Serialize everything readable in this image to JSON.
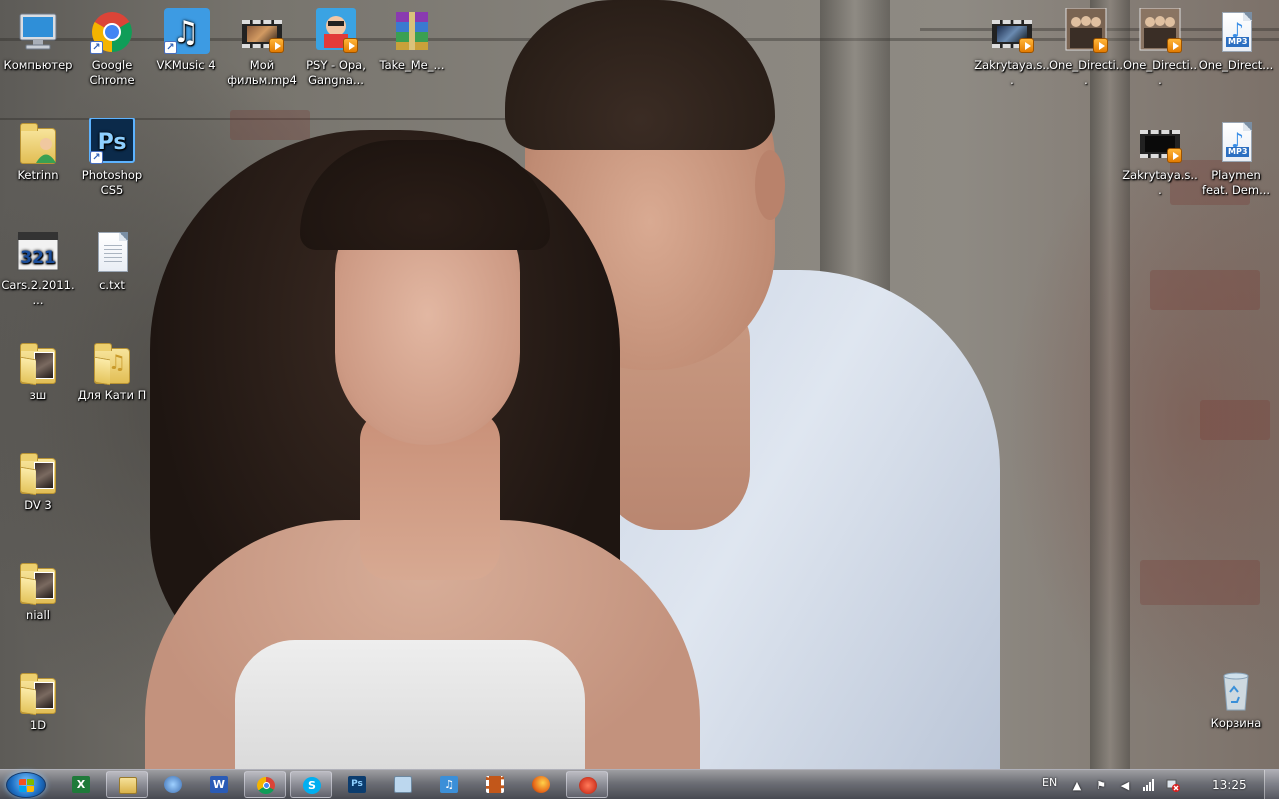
{
  "desktop": {
    "icons": [
      {
        "label": "Компьютер",
        "icon": "computer-icon"
      },
      {
        "label": "Google Chrome",
        "icon": "chrome-icon"
      },
      {
        "label": "VKMusic 4",
        "icon": "vkmusic-icon"
      },
      {
        "label": "Мой фильм.mp4",
        "icon": "video-file-icon"
      },
      {
        "label": "PSY - Opa, Gangna...",
        "icon": "video-file-icon"
      },
      {
        "label": "Take_Me_...",
        "icon": "winrar-archive-icon"
      },
      {
        "label": "Ketrinn",
        "icon": "user-folder-icon"
      },
      {
        "label": "Photoshop CS5",
        "icon": "photoshop-icon"
      },
      {
        "label": "Cars.2.2011....",
        "icon": "media-player-classic-icon"
      },
      {
        "label": "c.txt",
        "icon": "text-file-icon"
      },
      {
        "label": "зш",
        "icon": "folder-icon"
      },
      {
        "label": "Для Кати П",
        "icon": "folder-icon"
      },
      {
        "label": "DV 3",
        "icon": "folder-icon"
      },
      {
        "label": "niall",
        "icon": "folder-icon"
      },
      {
        "label": "1D",
        "icon": "folder-icon"
      },
      {
        "label": "Zakrytaya.s...",
        "icon": "video-file-icon"
      },
      {
        "label": "One_Directi...",
        "icon": "video-file-icon"
      },
      {
        "label": "One_Directi...",
        "icon": "video-file-icon"
      },
      {
        "label": "One_Direct...",
        "icon": "mp3-file-icon"
      },
      {
        "label": "Zakrytaya.s...",
        "icon": "video-file-icon"
      },
      {
        "label": "Playmen feat. Dem...",
        "icon": "mp3-file-icon"
      },
      {
        "label": "Корзина",
        "icon": "recycle-bin-icon"
      }
    ]
  },
  "taskbar": {
    "pinned": [
      {
        "name": "excel",
        "letter": "X",
        "color": "#1f7a3a"
      },
      {
        "name": "explorer",
        "letter": "",
        "color": "#e5c35a"
      },
      {
        "name": "media",
        "letter": "",
        "color": "#3d6fb3"
      },
      {
        "name": "word",
        "letter": "W",
        "color": "#2a5bb6"
      },
      {
        "name": "chrome",
        "letter": "",
        "color": "#dd4b39"
      },
      {
        "name": "skype",
        "letter": "S",
        "color": "#00aff0"
      },
      {
        "name": "photoshop",
        "letter": "Ps",
        "color": "#0b3c6e"
      },
      {
        "name": "notepad",
        "letter": "",
        "color": "#bcd7ee"
      },
      {
        "name": "vkmusic",
        "letter": "",
        "color": "#3b8fd8"
      },
      {
        "name": "video",
        "letter": "",
        "color": "#c2571a"
      },
      {
        "name": "firefox",
        "letter": "",
        "color": "#e86b1a"
      },
      {
        "name": "record",
        "letter": "",
        "color": "#d9402a"
      }
    ],
    "tray": {
      "language": "EN",
      "clock": "13:25"
    }
  }
}
